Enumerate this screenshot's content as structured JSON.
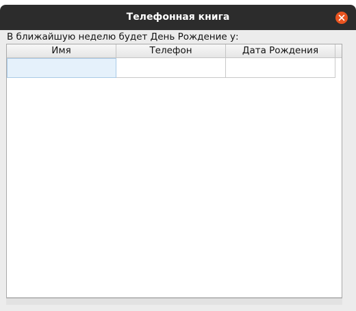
{
  "window": {
    "title": "Телефонная книга",
    "accent_color": "#e95420",
    "close_icon": "close-icon"
  },
  "caption": "В ближайшую неделю будет День Рождение у:",
  "table": {
    "columns": [
      "Имя",
      "Телефон",
      "Дата Рождения"
    ],
    "rows": [
      [
        "",
        "",
        ""
      ]
    ],
    "selected_cell": "row 1, column Имя"
  }
}
